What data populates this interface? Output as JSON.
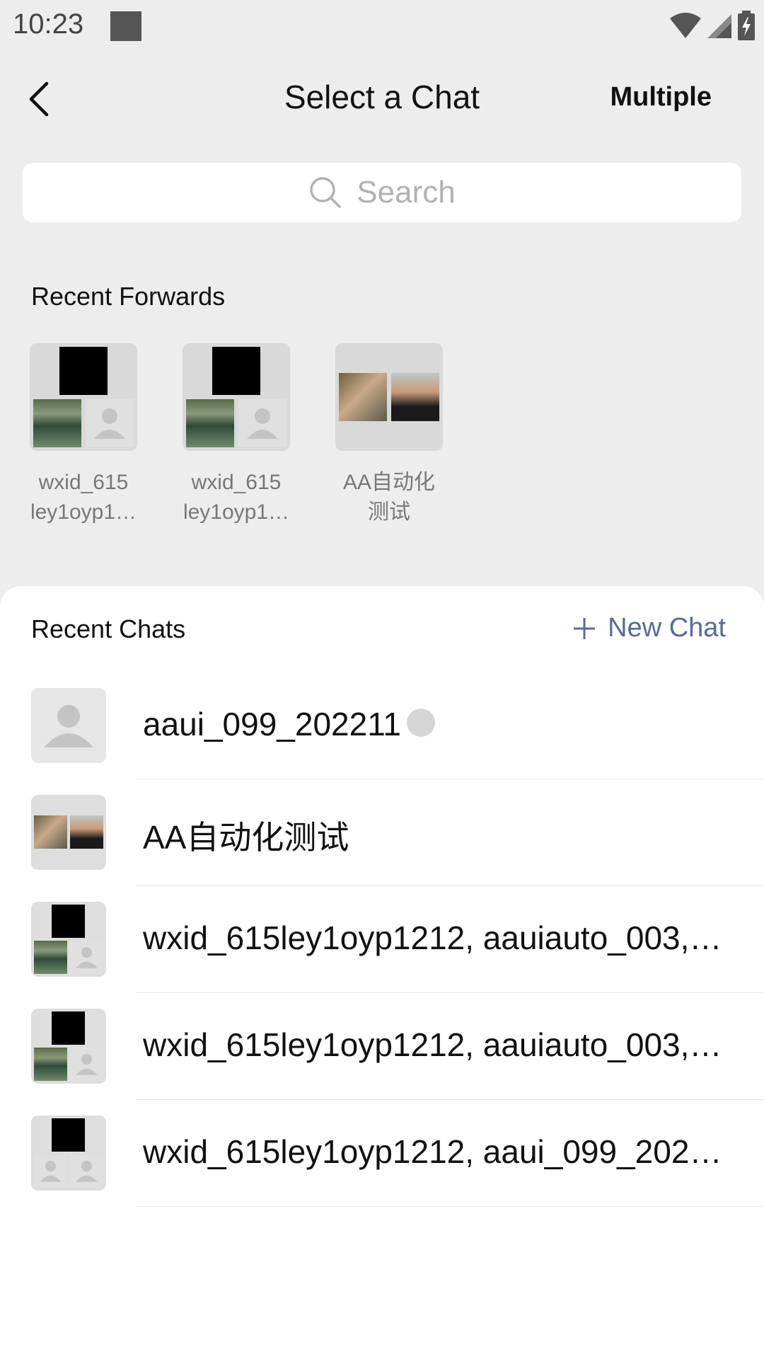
{
  "status_bar": {
    "time": "10:23"
  },
  "header": {
    "title": "Select a Chat",
    "multiple_label": "Multiple"
  },
  "search": {
    "placeholder": "Search"
  },
  "recent_forwards": {
    "label": "Recent Forwards",
    "items": [
      {
        "name": "wxid_615\nley1oyp1…"
      },
      {
        "name": "wxid_615\nley1oyp1…"
      },
      {
        "name": "AA自动化\n测试"
      }
    ]
  },
  "recent_chats": {
    "label": "Recent Chats",
    "new_chat_label": "New Chat",
    "items": [
      {
        "name": "aaui_099_202211"
      },
      {
        "name": "AA自动化测试"
      },
      {
        "name": "wxid_615ley1oyp1212, aauiauto_003, a…"
      },
      {
        "name": "wxid_615ley1oyp1212, aauiauto_003, a…"
      },
      {
        "name": "wxid_615ley1oyp1212, aaui_099_2022…"
      }
    ]
  },
  "colors": {
    "link": "#576b95",
    "background": "#ededed",
    "sheet": "#ffffff"
  }
}
